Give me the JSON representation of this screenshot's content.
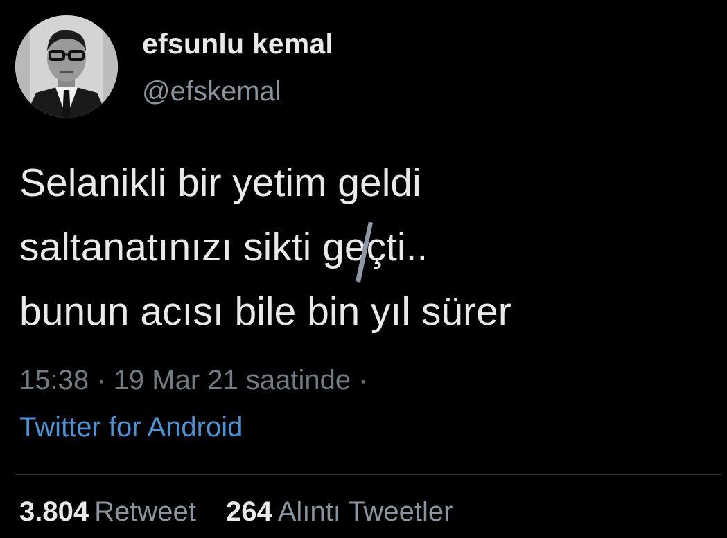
{
  "author": {
    "display_name": "efsunlu kemal",
    "handle": "@efskemal",
    "avatar_icon": "profile-photo"
  },
  "tweet": {
    "lines": [
      "Selanikli bir yetim geldi",
      "saltanatınızı sikti geçti..",
      "bunun acısı bile bin yıl sürer"
    ]
  },
  "meta": {
    "time": "15:38",
    "separator": "·",
    "date": "19 Mar 21 saatinde",
    "trailing_separator": "·",
    "source": "Twitter for Android"
  },
  "stats": {
    "retweets": {
      "count": "3.804",
      "label": "Retweet"
    },
    "quotes": {
      "count": "264",
      "label": "Alıntı Tweetler"
    }
  },
  "colors": {
    "background": "#000000",
    "primary_text": "#e7e9ea",
    "secondary_text": "#8b949c",
    "link": "#4a94d8"
  }
}
